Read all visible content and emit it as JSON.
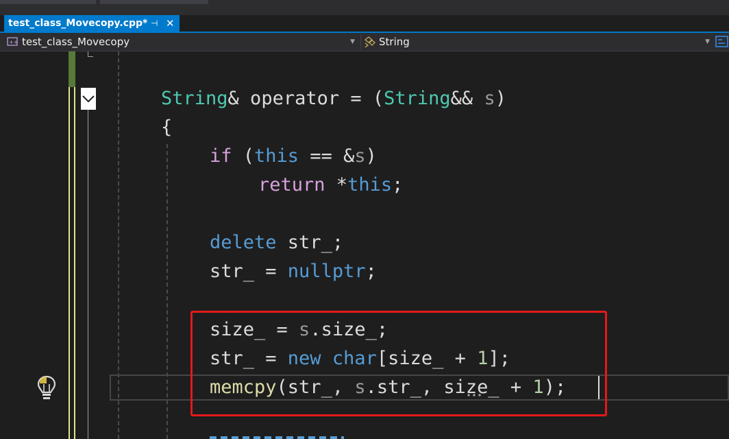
{
  "tab": {
    "title": "test_class_Movecopy.cpp*",
    "pin_icon": "pin-icon",
    "close_glyph": "✕"
  },
  "navbar": {
    "project_scope": "test_class_Movecopy",
    "member_scope": "String"
  },
  "colors": {
    "accent": "#007acc",
    "highlight_box": "#e51919",
    "keyword": "#569cd6",
    "control": "#d8a0df",
    "type": "#4ec9b0",
    "function": "#dcdcaa",
    "number": "#b5cea8"
  },
  "code": {
    "line1": {
      "t1": "String",
      "t2": "& operator = (",
      "t3": "String",
      "t4": "&& ",
      "t5": "s",
      "t6": ")"
    },
    "line2": {
      "t1": "{"
    },
    "line3": {
      "t1": "if",
      "t2": " (",
      "t3": "this",
      "t4": " == &",
      "t5": "s",
      "t6": ")"
    },
    "line4": {
      "t1": "return",
      "t2": " *",
      "t3": "this",
      "t4": ";"
    },
    "line5": {
      "t1": "delete",
      "t2": " str_;"
    },
    "line6": {
      "t1": "str_ = ",
      "t2": "nullptr",
      "t3": ";"
    },
    "line7": {
      "t1": "size_ = ",
      "t2": "s",
      "t3": ".size_;"
    },
    "line8": {
      "t1": "str_ = ",
      "t2": "new",
      "t3": " ",
      "t4": "char",
      "t5": "[size_ + ",
      "t6": "1",
      "t7": "];"
    },
    "line9": {
      "t1": "memcpy",
      "t2": "(str_, ",
      "t3": "s",
      "t4": ".str_, size_ + ",
      "t5": "1",
      "t6": ");"
    }
  }
}
